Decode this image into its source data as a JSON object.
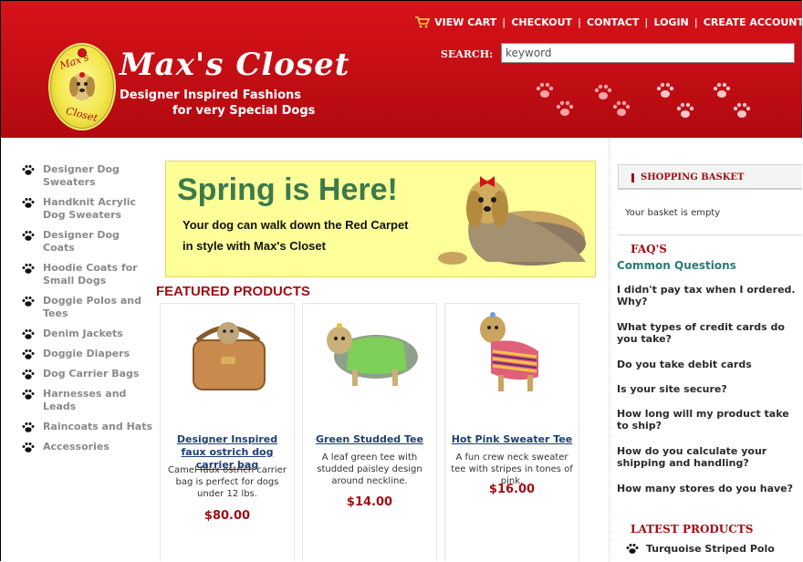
{
  "topnav": {
    "view_cart": "VIEW CART",
    "checkout": "CHECKOUT",
    "contact": "CONTACT",
    "login": "LOGIN",
    "create_account": "CREATE ACCOUNT"
  },
  "brand": {
    "logo_top": "Max's",
    "logo_bottom": "Closet",
    "title": "Max's Closet",
    "subtitle_line1": "Designer Inspired Fashions",
    "subtitle_line2": "for very Special Dogs"
  },
  "search": {
    "label": "SEARCH:",
    "placeholder": "keyword"
  },
  "sidebar": {
    "items": [
      {
        "label": "Designer Dog Sweaters"
      },
      {
        "label": "Handknit Acrylic Dog Sweaters"
      },
      {
        "label": "Designer Dog Coats"
      },
      {
        "label": "Hoodie Coats for Small Dogs"
      },
      {
        "label": "Doggie Polos and Tees"
      },
      {
        "label": "Denim Jackets"
      },
      {
        "label": "Doggie Diapers"
      },
      {
        "label": "Dog Carrier Bags"
      },
      {
        "label": "Harnesses and Leads"
      },
      {
        "label": "Raincoats and Hats"
      },
      {
        "label": "Accessories"
      }
    ]
  },
  "banner": {
    "headline": "Spring is Here!",
    "line1": "Your dog can walk down the Red Carpet",
    "line2": "in style with Max's Closet"
  },
  "featured": {
    "heading": "FEATURED PRODUCTS",
    "products": [
      {
        "title": "Designer Inspired faux ostrich dog carrier bag",
        "description": "Camel faux ostrich carrier bag is perfect for dogs under 12 lbs.",
        "price": "$80.00"
      },
      {
        "title": "Green Studded Tee",
        "description": "A leaf green tee with studded paisley design around neckline.",
        "price": "$14.00"
      },
      {
        "title": "Hot Pink Sweater Tee",
        "description": "A fun crew neck sweater tee with stripes in tones of pink.",
        "price": "$16.00"
      }
    ]
  },
  "basket": {
    "heading": "SHOPPING BASKET",
    "empty_text": "Your basket is empty"
  },
  "faq": {
    "heading": "FAQ'S",
    "subheading": "Common Questions",
    "questions": [
      "I didn't pay tax when I ordered. Why?",
      "What types of credit cards do you take?",
      "Do you take debit cards",
      "Is your site secure?",
      "How long will my product take to ship?",
      "How do you calculate your shipping and handling?",
      "How many stores do you have?"
    ]
  },
  "latest": {
    "heading": "LATEST PRODUCTS",
    "items": [
      "Turquoise Striped Polo"
    ]
  },
  "colors": {
    "header_red": "#c30d14",
    "accent_red": "#a00e14",
    "link_blue": "#1e3f73",
    "faq_teal": "#2a7a7a",
    "banner_yellow": "#ffff99",
    "banner_green": "#3b7a4d"
  }
}
